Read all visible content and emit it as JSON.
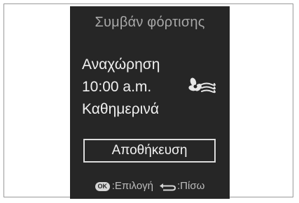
{
  "screen": {
    "title": "Συμβάν φόρτισης",
    "departure_label": "Αναχώρηση",
    "time": "10:00 a.m.",
    "repeat": "Καθημερινά",
    "climate_icon": "fan-airflow-icon",
    "save_label": "Αποθήκευση"
  },
  "footer": {
    "ok_key": "OK",
    "ok_label": ":Επιλογή",
    "back_icon": "back-arrow-icon",
    "back_label": ":Πίσω"
  },
  "colors": {
    "screen_bg": "#262626",
    "text": "#ececec",
    "title": "#a8a8a8"
  }
}
